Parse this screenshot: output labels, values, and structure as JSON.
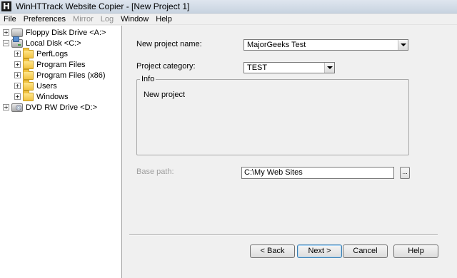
{
  "window": {
    "title": "WinHTTrack Website Copier - [New Project 1]",
    "app_icon_letter": "H"
  },
  "menu": [
    {
      "label": "File",
      "enabled": true
    },
    {
      "label": "Preferences",
      "enabled": true
    },
    {
      "label": "Mirror",
      "enabled": false
    },
    {
      "label": "Log",
      "enabled": false
    },
    {
      "label": "Window",
      "enabled": true
    },
    {
      "label": "Help",
      "enabled": true
    }
  ],
  "tree": {
    "floppy": "Floppy Disk Drive <A:>",
    "local": "Local Disk <C:>",
    "folders": [
      "PerfLogs",
      "Program Files",
      "Program Files (x86)",
      "Users",
      "Windows"
    ],
    "dvd": "DVD RW Drive <D:>"
  },
  "form": {
    "project_name_label": "New project name:",
    "project_name_value": "MajorGeeks Test",
    "category_label": "Project category:",
    "category_value": "TEST",
    "info_legend": "Info",
    "info_text": "New project",
    "base_path_label": "Base path:",
    "base_path_value": "C:\\My Web Sites",
    "browse_label": "..."
  },
  "buttons": {
    "back": "< Back",
    "next": "Next >",
    "cancel": "Cancel",
    "help": "Help"
  }
}
